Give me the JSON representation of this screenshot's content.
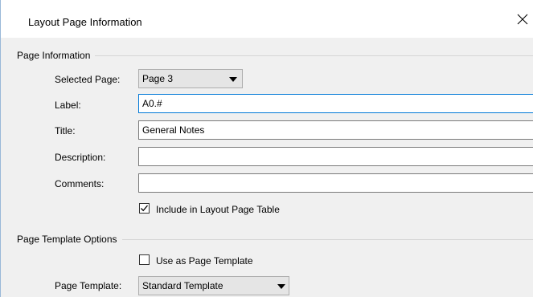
{
  "dialog": {
    "title": "Layout Page Information",
    "close_icon": "close-icon"
  },
  "page_info": {
    "group_label": "Page Information",
    "selected_page": {
      "label": "Selected Page:",
      "value": "Page 3"
    },
    "label_field": {
      "label": "Label:",
      "value": "A0.#"
    },
    "title_field": {
      "label": "Title:",
      "value": "General Notes"
    },
    "description_field": {
      "label": "Description:",
      "value": ""
    },
    "comments_field": {
      "label": "Comments:",
      "value": ""
    },
    "include_in_table": {
      "label": "Include in Layout Page Table",
      "checked": true
    }
  },
  "template_options": {
    "group_label": "Page Template Options",
    "use_as_template": {
      "label": "Use as Page Template",
      "checked": false
    },
    "page_template": {
      "label": "Page Template:",
      "value": "Standard Template"
    }
  },
  "colors": {
    "focus_border": "#0078d7",
    "window_bg": "#f0f0f0"
  }
}
